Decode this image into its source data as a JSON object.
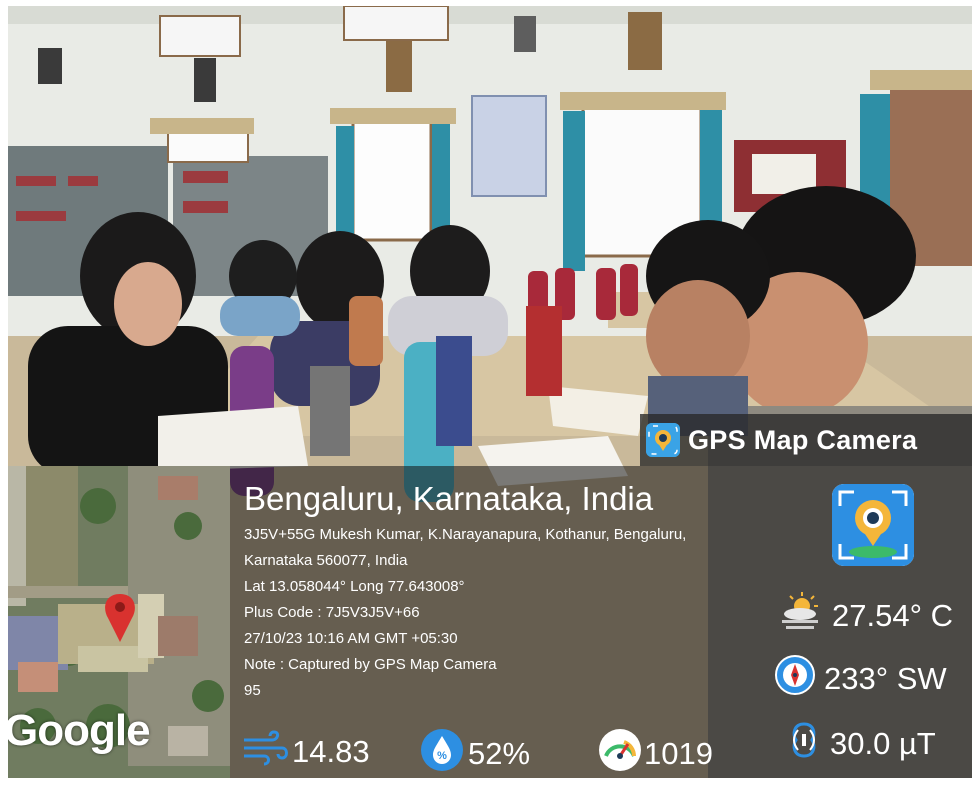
{
  "app": {
    "brand": "GPS Map Camera"
  },
  "location": {
    "title": "Bengaluru, Karnataka, India",
    "address_line1": "3J5V+55G Mukesh Kumar, K.Narayanapura, Kothanur, Bengaluru,",
    "address_line2": "Karnataka 560077, India",
    "coordinates": "Lat 13.058044° Long 77.643008°",
    "plus_code": "Plus Code : 7J5V3J5V+66",
    "datetime": "27/10/23 10:16 AM GMT +05:30",
    "note": "Note : Captured by GPS Map Camera",
    "note_extra": "95"
  },
  "map": {
    "provider": "Google"
  },
  "stats": {
    "temperature": "27.54° C",
    "direction": "233° SW",
    "magnetic": "30.0 µT",
    "wind": "14.83",
    "humidity": "52%",
    "pressure": "1019"
  },
  "icons": {
    "app": "map-pin-camera-icon",
    "weather": "sun-cloud-icon",
    "compass": "compass-icon",
    "magnetic": "magnet-field-icon",
    "wind": "wind-icon",
    "humidity": "humidity-drop-icon",
    "pressure": "gauge-icon"
  },
  "colors": {
    "accent_blue": "#2d8fe2",
    "pin_red": "#d9322f",
    "overlay": "#141414"
  }
}
